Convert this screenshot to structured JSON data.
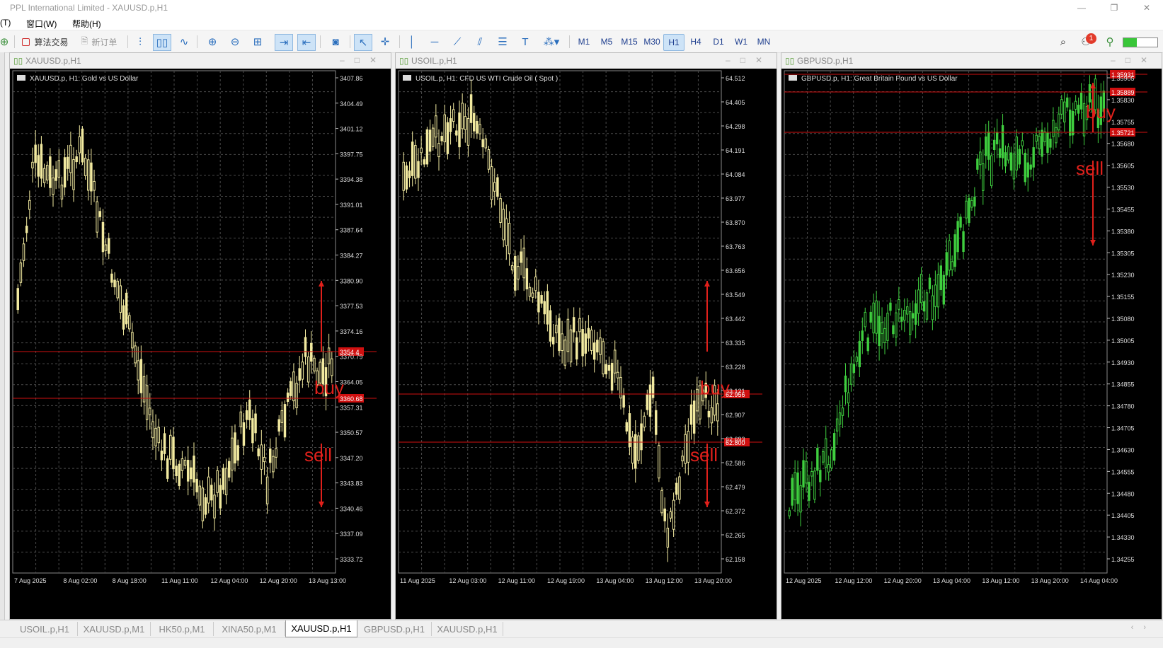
{
  "window": {
    "title": "PPL International Limited - XAUUSD.p,H1",
    "buttons": [
      "—",
      "❐",
      "✕"
    ]
  },
  "menu": {
    "items": [
      "(T)",
      "窗口(W)",
      "帮助(H)"
    ]
  },
  "toolbar": {
    "algo_trading": "算法交易",
    "new_order": "新订单",
    "timeframes": [
      "M1",
      "M5",
      "M15",
      "M30",
      "H1",
      "H4",
      "D1",
      "W1",
      "MN"
    ],
    "active_timeframe": "H1",
    "notification_count": "1"
  },
  "colors": {
    "chart_bg": "#000000",
    "grid": "#4a4a4a",
    "bull_yellow": "#f2eaa0",
    "bull_green": "#3fcf3f",
    "red_line": "#d01010",
    "annotation_red": "#e0201b"
  },
  "charts": [
    {
      "id": "xauusd",
      "window_caption": "XAUUSD.p,H1",
      "info": "XAUUSD.p, H1:  Gold vs US Dollar",
      "price_ticks": [
        "3407.86",
        "3404.49",
        "3401.12",
        "3397.75",
        "3394.38",
        "3391.01",
        "3387.64",
        "3384.27",
        "3380.90",
        "3377.53",
        "3374.16",
        "3370.79",
        "3364.05",
        "3357.31",
        "3350.57",
        "3347.20",
        "3343.83",
        "3340.46",
        "3337.09",
        "3333.72"
      ],
      "price_labels": [
        "3368.64",
        "3360.68",
        "3354.4"
      ],
      "time_ticks": [
        "7 Aug 2025",
        "8 Aug 02:00",
        "8 Aug 18:00",
        "11 Aug 11:00",
        "12 Aug 04:00",
        "12 Aug 20:00",
        "13 Aug 13:00"
      ],
      "annotations": [
        "buy",
        "sell"
      ]
    },
    {
      "id": "usoil",
      "window_caption": "USOIL.p,H1",
      "info": "USOIL.p, H1:  CFD US WTI Crude Oil ( Spot )",
      "price_ticks": [
        "64.512",
        "64.405",
        "64.298",
        "64.191",
        "64.084",
        "63.977",
        "63.870",
        "63.763",
        "63.656",
        "63.549",
        "63.442",
        "63.335",
        "63.228",
        "63.121",
        "62.907",
        "62.693",
        "62.586",
        "62.479",
        "62.372",
        "62.265",
        "62.158"
      ],
      "price_labels": [
        "62.956",
        "62.800"
      ],
      "time_ticks": [
        "11 Aug 2025",
        "12 Aug 03:00",
        "12 Aug 11:00",
        "12 Aug 19:00",
        "13 Aug 04:00",
        "13 Aug 12:00",
        "13 Aug 20:00"
      ],
      "annotations": [
        "buy",
        "sell"
      ]
    },
    {
      "id": "gbpusd",
      "window_caption": "GBPUSD.p,H1",
      "info": "GBPUSD.p, H1:  Great Britain Pound vs US Dollar",
      "price_ticks": [
        "1.35905",
        "1.35830",
        "1.35755",
        "1.35680",
        "1.35605",
        "1.35530",
        "1.35455",
        "1.35380",
        "1.35305",
        "1.35230",
        "1.35155",
        "1.35080",
        "1.35005",
        "1.34930",
        "1.34855",
        "1.34780",
        "1.34705",
        "1.34630",
        "1.34555",
        "1.34480",
        "1.34405",
        "1.34330",
        "1.34255"
      ],
      "price_labels": [
        "1.35931",
        "1.35889",
        "1.35721"
      ],
      "time_ticks": [
        "12 Aug 2025",
        "12 Aug 12:00",
        "12 Aug 20:00",
        "13 Aug 04:00",
        "13 Aug 12:00",
        "13 Aug 20:00",
        "14 Aug 04:00"
      ],
      "annotations": [
        "buy",
        "sell"
      ]
    }
  ],
  "tabs": [
    "USOIL.p,H1",
    "XAUUSD.p,M1",
    "HK50.p,M1",
    "XINA50.p,M1",
    "XAUUSD.p,H1",
    "GBPUSD.p,H1",
    "XAUUSD.p,H1"
  ],
  "active_tab_index": 4
}
